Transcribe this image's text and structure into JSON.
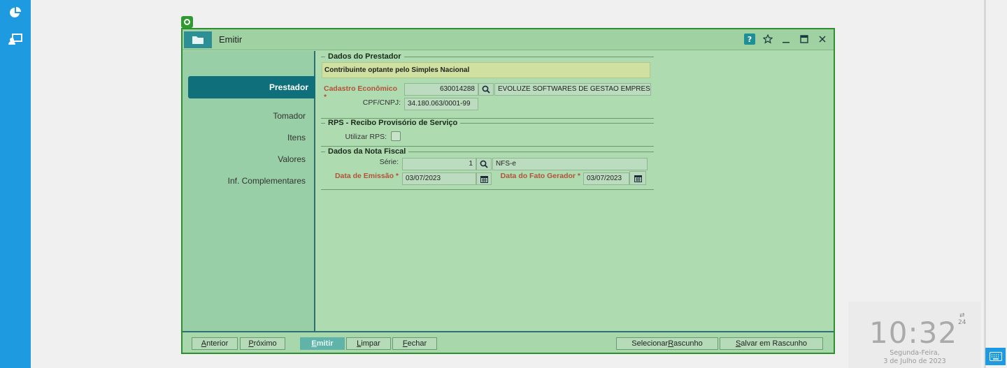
{
  "left_rail": {
    "icons": [
      "pie-chart-icon",
      "remote-desktop-icon"
    ]
  },
  "window": {
    "title": "Emitir",
    "tools": [
      "help-icon",
      "star-icon",
      "minimize-icon",
      "maximize-icon",
      "close-icon"
    ],
    "help_label": "?"
  },
  "nav": {
    "items": [
      {
        "label": "Prestador",
        "active": true
      },
      {
        "label": "Tomador",
        "active": false
      },
      {
        "label": "Itens",
        "active": false
      },
      {
        "label": "Valores",
        "active": false
      },
      {
        "label": "Inf. Complementares",
        "active": false
      }
    ]
  },
  "prestador": {
    "legend": "Dados do Prestador",
    "notice": "Contribuinte optante pelo Simples Nacional",
    "cadastro_label": "Cadastro Econômico *",
    "cadastro_value": "630014288",
    "cadastro_name": "EVOLUZE SOFTWARES DE GESTAO EMPRESARI",
    "cpf_label": "CPF/CNPJ:",
    "cpf_value": "34.180.063/0001-99"
  },
  "rps": {
    "legend": "RPS - Recibo Provisório de Serviço",
    "utilizar_label": "Utilizar RPS:",
    "utilizar_checked": false
  },
  "nota": {
    "legend": "Dados da Nota Fiscal",
    "serie_label": "Série:",
    "serie_value": "1",
    "serie_desc": "NFS-e",
    "emissao_label": "Data de Emissão *",
    "emissao_value": "03/07/2023",
    "fato_label": "Data do Fato Gerador *",
    "fato_value": "03/07/2023"
  },
  "buttons": {
    "anterior": "Anterior",
    "proximo": "Próximo",
    "emitir": "Emitir",
    "limpar": "Limpar",
    "fechar": "Fechar",
    "selecionar": "Selecionar Rascunho",
    "salvar": "Salvar em Rascunho"
  },
  "clock": {
    "time": "10:32",
    "format": "24",
    "weekday": "Segunda-Feira,",
    "date": "3 de Julho de 2023"
  },
  "colors": {
    "rail": "#1e9be0",
    "window_bg": "#aedcb0",
    "accent": "#0f6f7a",
    "required": "#b4513a"
  }
}
